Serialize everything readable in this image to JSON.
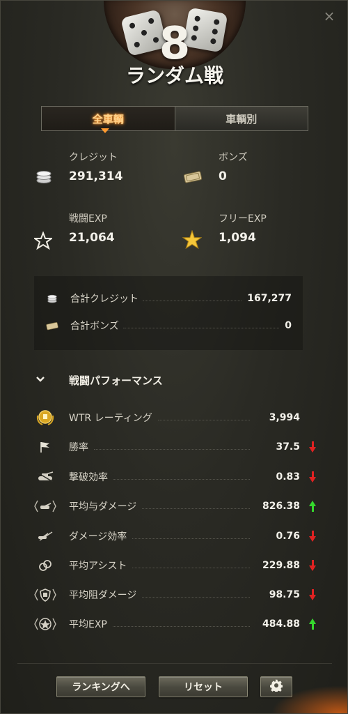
{
  "header": {
    "battles_count": "8",
    "mode_title": "ランダム戦",
    "close_icon": "×"
  },
  "tabs": [
    {
      "label": "全車輌",
      "active": true
    },
    {
      "label": "車輌別",
      "active": false
    }
  ],
  "earnings": {
    "credits": {
      "label": "クレジット",
      "value": "291,314",
      "icon": "coin-stack-icon"
    },
    "bonds": {
      "label": "ボンズ",
      "value": "0",
      "icon": "bond-icon"
    },
    "battle_exp": {
      "label": "戦闘EXP",
      "value": "21,064",
      "icon": "star-outline-icon"
    },
    "free_exp": {
      "label": "フリーEXP",
      "value": "1,094",
      "icon": "gold-star-icon"
    }
  },
  "totals": [
    {
      "label": "合計クレジット",
      "value": "167,277",
      "icon": "coin-stack-icon"
    },
    {
      "label": "合計ボンズ",
      "value": "0",
      "icon": "bond-icon"
    }
  ],
  "performance": {
    "title": "戦闘パフォーマンス",
    "rows": [
      {
        "label": "WTR レーティング",
        "value": "3,994",
        "trend": "none",
        "icon": "wtr-badge-icon"
      },
      {
        "label": "勝率",
        "value": "37.5",
        "trend": "down",
        "icon": "flag-icon"
      },
      {
        "label": "撃破効率",
        "value": "0.83",
        "trend": "down",
        "icon": "destroyed-tank-icon"
      },
      {
        "label": "平均与ダメージ",
        "value": "826.38",
        "trend": "up",
        "icon": "damage-dealt-icon"
      },
      {
        "label": "ダメージ効率",
        "value": "0.76",
        "trend": "down",
        "icon": "damage-ratio-icon"
      },
      {
        "label": "平均アシスト",
        "value": "229.88",
        "trend": "down",
        "icon": "assist-icon"
      },
      {
        "label": "平均阻ダメージ",
        "value": "98.75",
        "trend": "down",
        "icon": "blocked-damage-icon"
      },
      {
        "label": "平均EXP",
        "value": "484.88",
        "trend": "up",
        "icon": "exp-badge-icon"
      }
    ]
  },
  "footer": {
    "ranking_button": "ランキングへ",
    "reset_button": "リセット",
    "settings_icon": "gear-icon"
  },
  "colors": {
    "trend_up": "#35d82d",
    "trend_down": "#e02222",
    "tab_active_text": "#ffd28a",
    "gold_star": "#f5c73a"
  }
}
